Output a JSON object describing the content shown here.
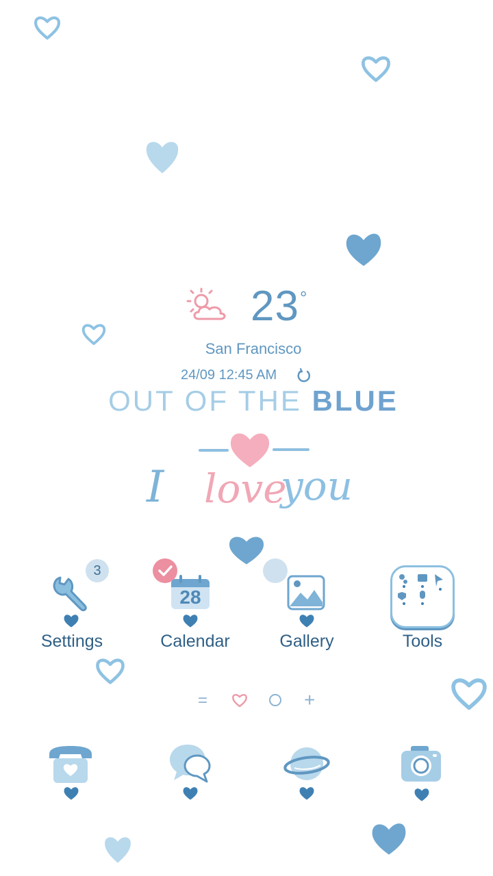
{
  "weather": {
    "temperature": "23",
    "degree_symbol": "°",
    "city": "San Francisco",
    "datetime": "24/09 12:45 AM"
  },
  "slogan": {
    "part1": "OUT OF THE ",
    "part2": "BLUE"
  },
  "love_text": {
    "i": "I",
    "love": "love",
    "you": "you"
  },
  "apps": [
    {
      "label": "Settings",
      "badge": "3"
    },
    {
      "label": "Calendar",
      "date_number": "28"
    },
    {
      "label": "Gallery"
    },
    {
      "label": "Tools"
    }
  ],
  "pager": {
    "menu_glyph": "=",
    "add_glyph": "+"
  },
  "dock": [
    {
      "icon": "phone-icon"
    },
    {
      "icon": "messages-icon"
    },
    {
      "icon": "internet-icon"
    },
    {
      "icon": "camera-icon"
    }
  ],
  "colors": {
    "primary_blue": "#5f97c1",
    "light_blue": "#a6cde6",
    "dark_blue": "#2f5f86",
    "pink": "#f1a7b5",
    "background": "#ffffff"
  }
}
